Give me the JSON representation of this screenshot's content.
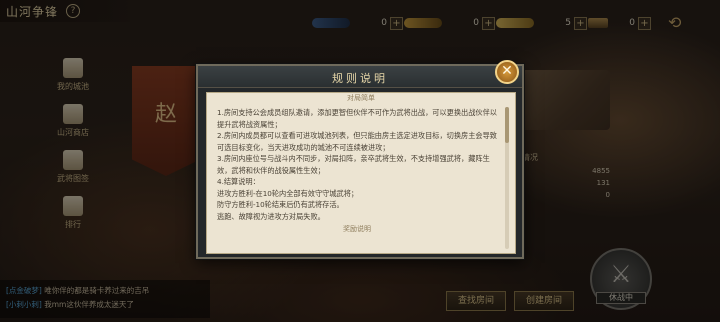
{
  "header": {
    "title": "山河争锋",
    "help_icon": "?"
  },
  "resources": [
    {
      "icon": "blue-token-icon",
      "value": "0",
      "plus": "+"
    },
    {
      "icon": "gold-token-icon",
      "value": "0",
      "plus": "+"
    },
    {
      "icon": "gold-ingot-icon",
      "value": "5",
      "plus": "+"
    },
    {
      "icon": "chest-icon",
      "value": "0",
      "plus": "+"
    }
  ],
  "nav": [
    {
      "label": "我的城池",
      "icon": "city-icon"
    },
    {
      "label": "山河商店",
      "icon": "shop-icon"
    },
    {
      "label": "武将图签",
      "icon": "scroll-icon"
    },
    {
      "label": "排行",
      "icon": "rank-icon"
    }
  ],
  "banner": {
    "char": "赵"
  },
  "stats": {
    "heading": "地情况",
    "values": [
      "4855",
      "131",
      "0"
    ]
  },
  "chat": {
    "lines": [
      {
        "tag": "[点金破梦]",
        "text": "唯你伴的都是骑卡养过来的吉吊"
      },
      {
        "tag": "[小刺小刺]",
        "text": "我mm这伙伴养成太迷天了"
      }
    ]
  },
  "buttons": {
    "find_room": "查找房间",
    "create_room": "创建房间",
    "war_status": "休战中"
  },
  "modal": {
    "title": "规则说明",
    "close": "✕",
    "subtitle": "对局简单",
    "rules": [
      "1.房间支持公会成员组队邀请，添加更智但伙伴不可作为武将出战，可以更换出战伙伴以提升武将战资属性；",
      "2.房间内成员都可以查看可进攻城池列表，但只能由房主选定进攻目标，切换房主会导致可选目标变化，当天进攻成功的城池不可连续被进攻；",
      "3.房间内座位号与战斗内不同步，对局扣阵，亲卒武将生效，不支持增强武将，藏阵生效，武将和伙伴的战役属性生效；",
      "4.结算说明：",
      "进攻方胜利-在10轮内全部有效守守城武将；",
      "防守方胜利-10轮结束后仍有武将存活。",
      "逃跑、故障视为进攻方对局失败。"
    ],
    "cut_heading": "奖励说明"
  }
}
